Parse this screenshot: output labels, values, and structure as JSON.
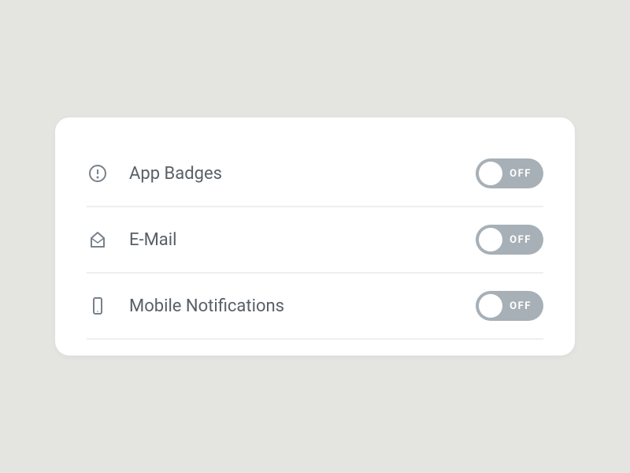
{
  "settings": [
    {
      "icon": "alert-circle",
      "label": "App Badges",
      "toggle_state": "OFF"
    },
    {
      "icon": "mail-open",
      "label": "E-Mail",
      "toggle_state": "OFF"
    },
    {
      "icon": "mobile",
      "label": "Mobile Notifications",
      "toggle_state": "OFF"
    }
  ]
}
